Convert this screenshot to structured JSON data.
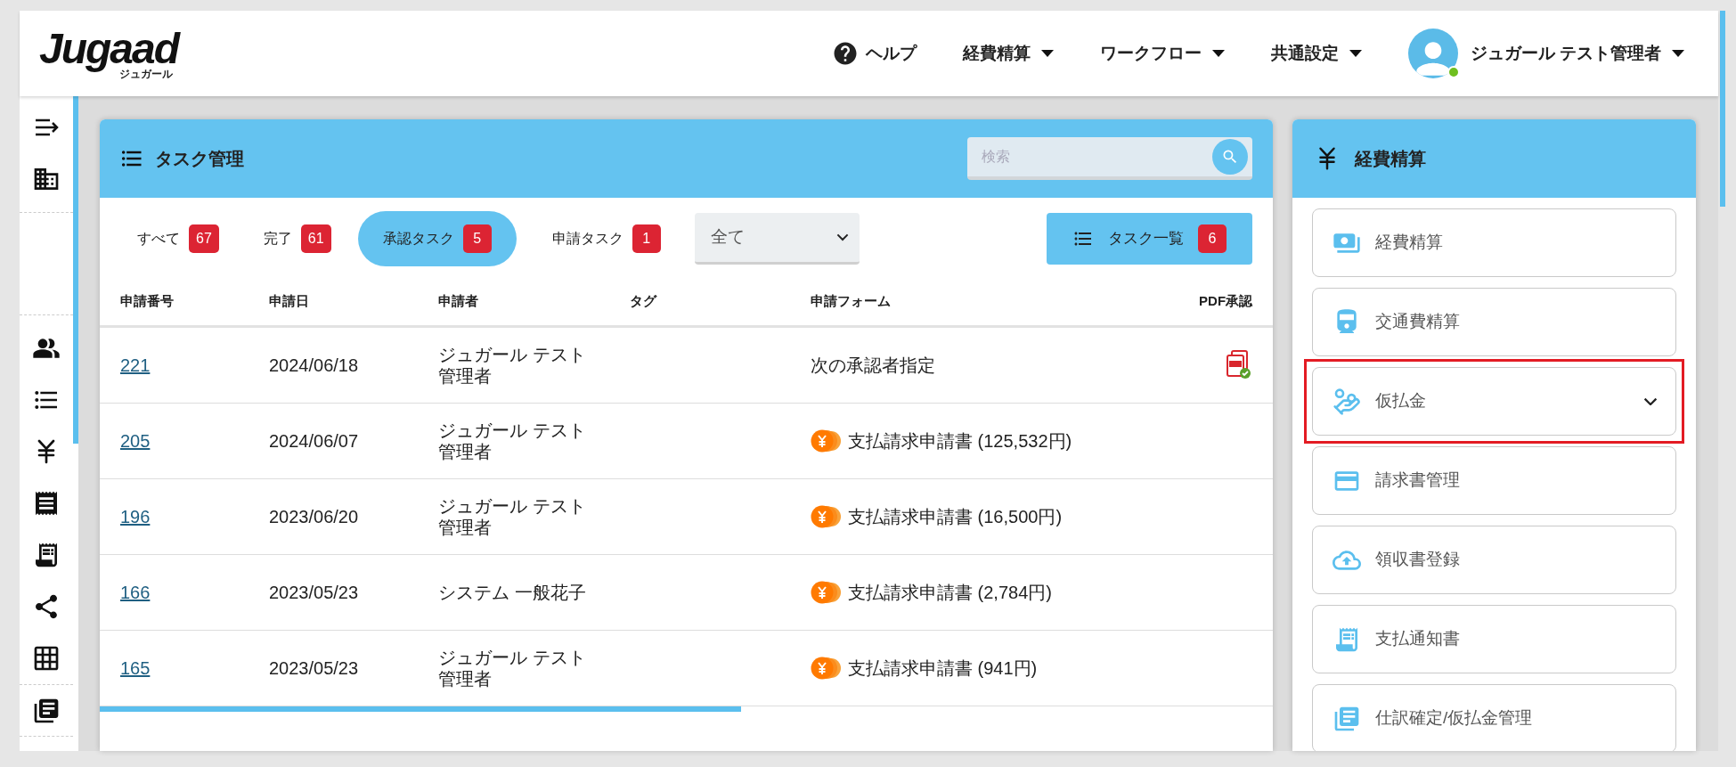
{
  "header": {
    "logo": "Jugaad",
    "logo_sub": "ジュガール",
    "nav": [
      {
        "label": "ヘルプ",
        "kind": "help"
      },
      {
        "label": "経費精算",
        "kind": "menu"
      },
      {
        "label": "ワークフロー",
        "kind": "menu"
      },
      {
        "label": "共通設定",
        "kind": "menu"
      }
    ],
    "user": {
      "name": "ジュガール テスト管理者",
      "online": true
    }
  },
  "task_panel": {
    "title": "タスク管理",
    "search": {
      "placeholder": "検索"
    },
    "filters": [
      {
        "label": "すべて",
        "count": "67",
        "selected": false
      },
      {
        "label": "完了",
        "count": "61",
        "selected": false
      },
      {
        "label": "承認タスク",
        "count": "5",
        "selected": true
      },
      {
        "label": "申請タスク",
        "count": "1",
        "selected": false
      }
    ],
    "select": {
      "value": "全て"
    },
    "list_button": {
      "label": "タスク一覧",
      "count": "6"
    },
    "columns": [
      "申請番号",
      "申請日",
      "申請者",
      "タグ",
      "申請フォーム",
      "PDF承認"
    ],
    "rows": [
      {
        "number": "221",
        "date": "2024/06/18",
        "applicant": "ジュガール テスト管理者",
        "form": "次の承認者指定",
        "coin": false,
        "pdf": true
      },
      {
        "number": "205",
        "date": "2024/06/07",
        "applicant": "ジュガール テスト管理者",
        "form": "支払請求申請書 (125,532円)",
        "coin": true,
        "pdf": false
      },
      {
        "number": "196",
        "date": "2023/06/20",
        "applicant": "ジュガール テスト管理者",
        "form": "支払請求申請書 (16,500円)",
        "coin": true,
        "pdf": false
      },
      {
        "number": "166",
        "date": "2023/05/23",
        "applicant": "システム 一般花子",
        "form": "支払請求申請書 (2,784円)",
        "coin": true,
        "pdf": false
      },
      {
        "number": "165",
        "date": "2023/05/23",
        "applicant": "ジュガール テスト管理者",
        "form": "支払請求申請書 (941円)",
        "coin": true,
        "pdf": false
      }
    ]
  },
  "expense_panel": {
    "title": "経費精算",
    "items": [
      {
        "label": "経費精算",
        "highlighted": false,
        "submenu": false
      },
      {
        "label": "交通費精算",
        "highlighted": false,
        "submenu": false
      },
      {
        "label": "仮払金",
        "highlighted": true,
        "submenu": true
      },
      {
        "label": "請求書管理",
        "highlighted": false,
        "submenu": false
      },
      {
        "label": "領収書登録",
        "highlighted": false,
        "submenu": false
      },
      {
        "label": "支払通知書",
        "highlighted": false,
        "submenu": false
      },
      {
        "label": "仕訳確定/仮払金管理",
        "highlighted": false,
        "submenu": false
      }
    ]
  }
}
